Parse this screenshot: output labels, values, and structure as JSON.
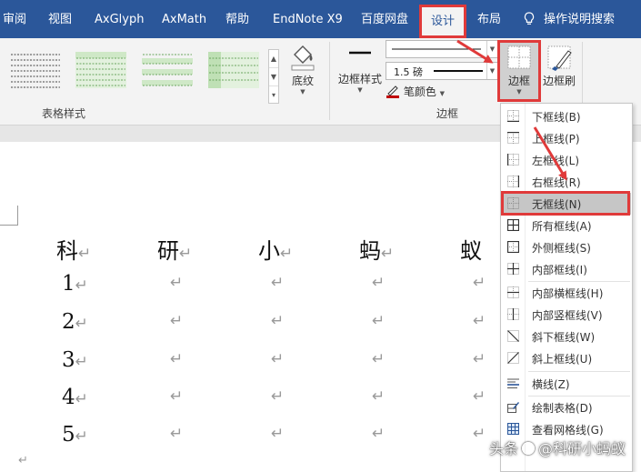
{
  "tabs": [
    {
      "label": "审阅",
      "active": false
    },
    {
      "label": "视图",
      "active": false
    },
    {
      "label": "AxGlyph",
      "active": false
    },
    {
      "label": "AxMath",
      "active": false
    },
    {
      "label": "帮助",
      "active": false
    },
    {
      "label": "EndNote X9",
      "active": false
    },
    {
      "label": "百度网盘",
      "active": false
    },
    {
      "label": "设计",
      "active": true
    },
    {
      "label": "布局",
      "active": false
    }
  ],
  "tell_me": "操作说明搜索",
  "ribbon": {
    "table_styles_label": "表格样式",
    "shading_label": "底纹",
    "border_styles_label": "边框样式",
    "line_style_value": "",
    "line_weight_value": "1.5 磅",
    "pen_color_label": "笔颜色",
    "borders_group_label": "边框",
    "borders_button_label": "边框",
    "border_painter_label": "边框刷"
  },
  "colors": {
    "accent": "#2b579a",
    "highlight_red": "#e03a3a",
    "menu_highlight": "#c6c6c6",
    "table_style_green": "#cfe8c7",
    "pen_color": "#c00000"
  },
  "borders_menu": {
    "items": [
      {
        "label": "下框线(B)",
        "icon": "bottom-border-icon",
        "highlighted": false
      },
      {
        "label": "上框线(P)",
        "icon": "top-border-icon",
        "highlighted": false
      },
      {
        "label": "左框线(L)",
        "icon": "left-border-icon",
        "highlighted": false
      },
      {
        "label": "右框线(R)",
        "icon": "right-border-icon",
        "highlighted": false
      },
      {
        "label": "无框线(N)",
        "icon": "no-border-icon",
        "highlighted": true
      },
      {
        "label": "所有框线(A)",
        "icon": "all-borders-icon",
        "highlighted": false
      },
      {
        "label": "外侧框线(S)",
        "icon": "outside-borders-icon",
        "highlighted": false
      },
      {
        "label": "内部框线(I)",
        "icon": "inside-borders-icon",
        "highlighted": false
      },
      {
        "label": "内部横框线(H)",
        "icon": "inside-horizontal-border-icon",
        "highlighted": false
      },
      {
        "label": "内部竖框线(V)",
        "icon": "inside-vertical-border-icon",
        "highlighted": false
      },
      {
        "label": "斜下框线(W)",
        "icon": "diagonal-down-border-icon",
        "highlighted": false
      },
      {
        "label": "斜上框线(U)",
        "icon": "diagonal-up-border-icon",
        "highlighted": false
      },
      {
        "label": "横线(Z)",
        "icon": "horizontal-line-icon",
        "highlighted": false
      },
      {
        "label": "绘制表格(D)",
        "icon": "draw-table-icon",
        "highlighted": false
      },
      {
        "label": "查看网格线(G)",
        "icon": "view-gridlines-icon",
        "highlighted": false
      }
    ]
  },
  "document": {
    "header_row": [
      "科",
      "研",
      "小",
      "蚂",
      "蚁"
    ],
    "row_numbers": [
      "1",
      "2",
      "3",
      "4",
      "5"
    ],
    "paragraph_mark": "↵"
  },
  "watermark": {
    "prefix": "头条",
    "name": "@科研小蚂蚁"
  }
}
